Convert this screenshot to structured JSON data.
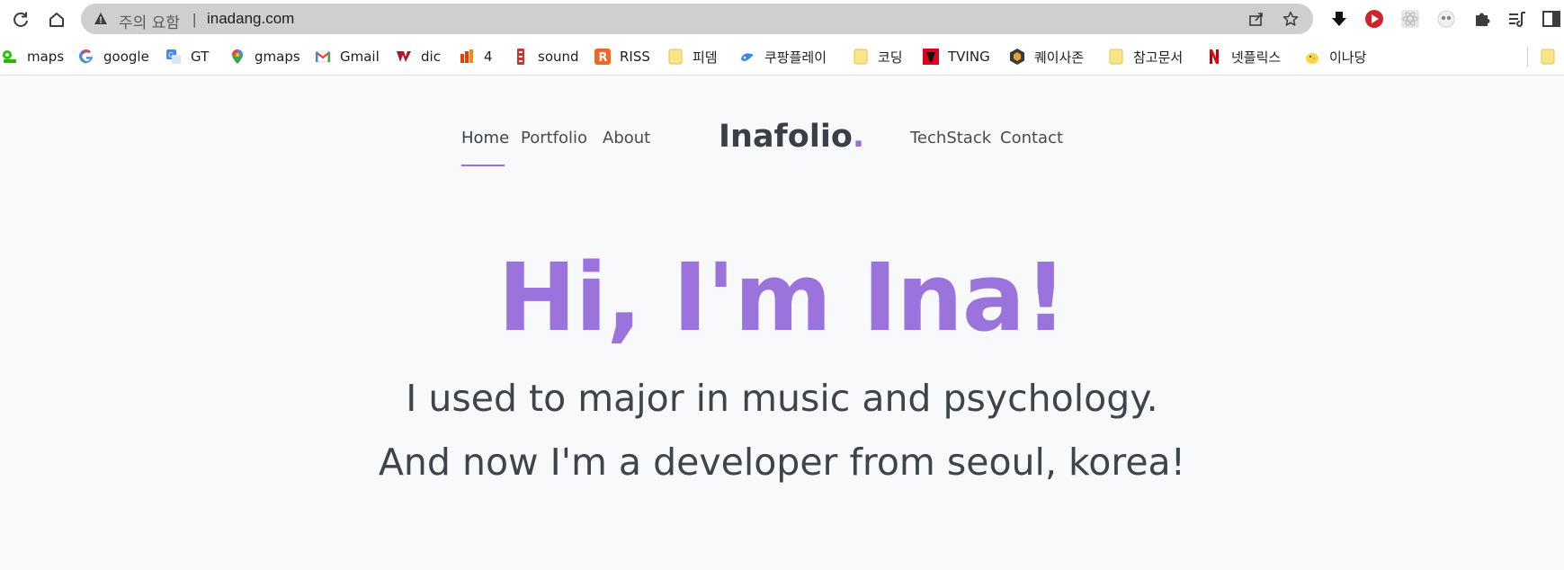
{
  "browser": {
    "security_label": "주의 요함",
    "separator": "|",
    "url": "inadang.com"
  },
  "bookmarks": [
    {
      "label": "maps",
      "icon": "maps-icon"
    },
    {
      "label": "google",
      "icon": "google-icon"
    },
    {
      "label": "GT",
      "icon": "translate-icon"
    },
    {
      "label": "gmaps",
      "icon": "gmaps-pin-icon"
    },
    {
      "label": "Gmail",
      "icon": "gmail-icon"
    },
    {
      "label": "dic",
      "icon": "dictionary-icon"
    },
    {
      "label": "4",
      "icon": "office-icon"
    },
    {
      "label": "sound",
      "icon": "sound-icon"
    },
    {
      "label": "RISS",
      "icon": "riss-icon"
    },
    {
      "label": "피뎀",
      "icon": "folder-icon"
    },
    {
      "label": "쿠팡플레이",
      "icon": "coupang-play-icon"
    },
    {
      "label": "코딩",
      "icon": "folder-icon"
    },
    {
      "label": "TVING",
      "icon": "tving-icon"
    },
    {
      "label": "퀘이사존",
      "icon": "quasarzone-icon"
    },
    {
      "label": "참고문서",
      "icon": "folder-icon"
    },
    {
      "label": "넷플릭스",
      "icon": "netflix-icon"
    },
    {
      "label": "이나당",
      "icon": "chick-icon"
    }
  ],
  "nav": {
    "left": [
      "Home",
      "Portfolio",
      "About"
    ],
    "brand": "Inafolio",
    "brand_dot": ".",
    "right": [
      "TechStack",
      "Contact"
    ],
    "active": "Home"
  },
  "hero": {
    "title": "Hi, I'm Ina!",
    "line1": "I used to major in music and psychology.",
    "line2": "And now I'm a developer from seoul, korea!"
  },
  "colors": {
    "accent": "#9b73dc",
    "text": "#3f444c",
    "page_bg": "#f8f9fa"
  }
}
